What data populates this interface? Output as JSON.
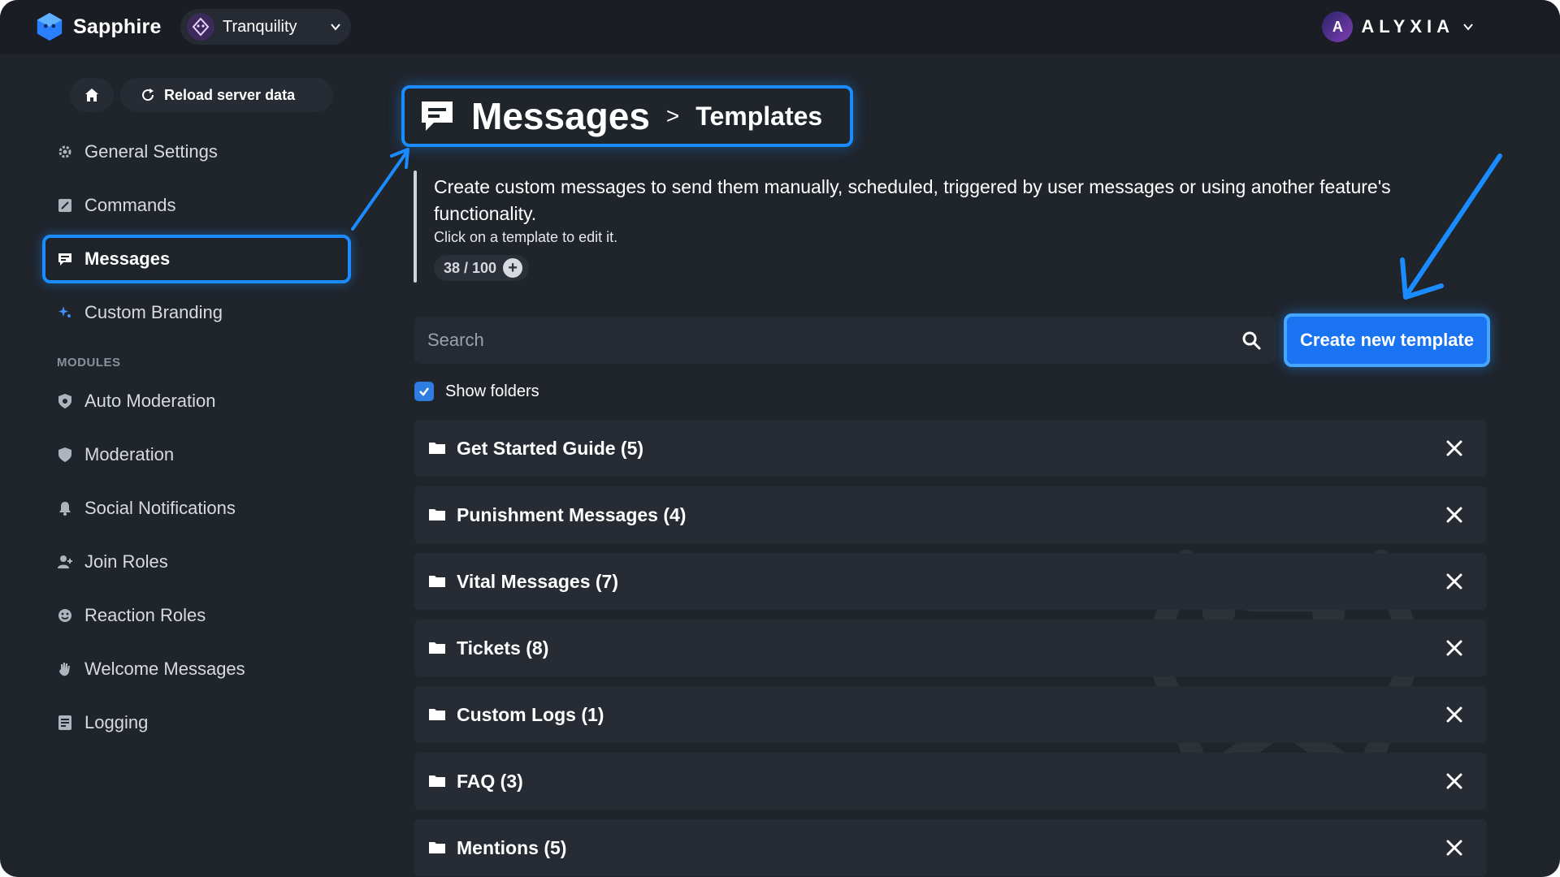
{
  "topbar": {
    "brand_name": "Sapphire",
    "server_name": "Tranquility",
    "account_name": "ALYXIA",
    "account_initial": "A"
  },
  "sidebar": {
    "reload_label": "Reload server data",
    "items": [
      {
        "label": "General Settings",
        "icon": "gear-icon"
      },
      {
        "label": "Commands",
        "icon": "command-icon"
      },
      {
        "label": "Messages",
        "icon": "message-icon"
      },
      {
        "label": "Custom Branding",
        "icon": "sparkle-icon"
      }
    ],
    "modules_label": "MODULES",
    "modules": [
      {
        "label": "Auto Moderation",
        "icon": "shield-gear-icon"
      },
      {
        "label": "Moderation",
        "icon": "shield-icon"
      },
      {
        "label": "Social Notifications",
        "icon": "bell-icon"
      },
      {
        "label": "Join Roles",
        "icon": "user-add-icon"
      },
      {
        "label": "Reaction Roles",
        "icon": "smiley-icon"
      },
      {
        "label": "Welcome Messages",
        "icon": "wave-hand-icon"
      },
      {
        "label": "Logging",
        "icon": "log-icon"
      }
    ]
  },
  "header": {
    "title": "Messages",
    "separator": ">",
    "subtitle": "Templates"
  },
  "description": {
    "main": "Create custom messages to send them manually, scheduled, triggered by user messages or using another feature's functionality.",
    "hint": "Click on a template to edit it.",
    "count": "38 / 100"
  },
  "search": {
    "placeholder": "Search",
    "value": ""
  },
  "create_button": "Create new template",
  "show_folders": {
    "label": "Show folders",
    "checked": true
  },
  "folders": [
    "Get Started Guide (5)",
    "Punishment Messages (4)",
    "Vital Messages (7)",
    "Tickets (8)",
    "Custom Logs (1)",
    "FAQ (3)",
    "Mentions (5)"
  ],
  "colors": {
    "accent": "#1a8cff",
    "background": "#20242b",
    "topbar": "#1a1d23",
    "row": "#272b33"
  }
}
